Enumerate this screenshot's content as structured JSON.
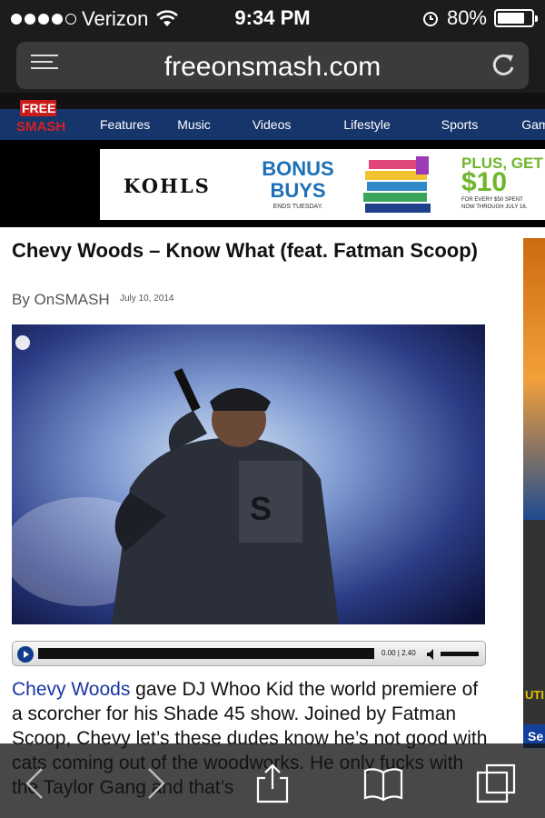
{
  "status_bar": {
    "carrier": "Verizon",
    "time": "9:34 PM",
    "battery": "80%",
    "battery_level": 0.8,
    "signal_bars": 4
  },
  "browser": {
    "url": "freeonsmash.com"
  },
  "site": {
    "logo_text": "SMASH",
    "nav": [
      "Features",
      "Music",
      "Videos",
      "Lifestyle",
      "Sports",
      "Gaming"
    ]
  },
  "ad": {
    "brand": "KOHLS",
    "headline_1": "BONUS",
    "headline_2": "BUYS",
    "ends": "ENDS TUESDAY.",
    "promo_1": "PLUS, GET",
    "promo_2": "$10",
    "promo_3": "FOR EVERY $50 SPENT",
    "promo_4": "NOW THROUGH JULY 16."
  },
  "article": {
    "title": "Chevy Woods – Know What (feat. Fatman Scoop)",
    "byline": "By OnSMASH",
    "date": "July 10, 2014",
    "player_time": "0.00 | 2.40",
    "body_link": "Chevy Woods",
    "body_rest": " gave DJ Whoo Kid the world premiere of a scorcher for his Shade 45 show. Joined by Fatman Scoop, Chevy let’s these dudes know he’s not good with cats coming out of the woodworks. He only fucks with the Taylor Gang and that’s"
  },
  "sidebar": {
    "label": "UTI",
    "button": "Se"
  },
  "colors": {
    "nav_blue": "#16356b",
    "link_blue": "#1a35a4",
    "kohls_blue": "#1d70b8",
    "kohls_green": "#6eb62b"
  }
}
